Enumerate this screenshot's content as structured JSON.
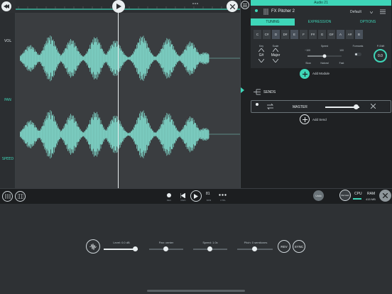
{
  "lanes": [
    "VOL",
    "PAN",
    "SPEED"
  ],
  "plugin": {
    "top_title": "Audio 21",
    "name": "FX Pitcher 2",
    "preset": "Default",
    "tabs": [
      "TUNING",
      "EXPRESSION",
      "OPTIONS"
    ],
    "notes": [
      "C",
      "C#",
      "D",
      "D#",
      "E",
      "F",
      "F#",
      "G",
      "G#",
      "A",
      "A#",
      "B"
    ],
    "key_label": "Key",
    "key_value": "G#",
    "scale_label": "Scale",
    "scale_value": "Major",
    "speed_label": "Speed",
    "speed_min": "−100",
    "speed_max": "100",
    "speed_slow": "Slow",
    "speed_natural": "Natural",
    "speed_fast": "Fast",
    "formants_label": "Formants",
    "pshift_label": "P-Shift",
    "pshift_value": "0.0"
  },
  "add_module": "Add Module",
  "sends": {
    "title": "SENDS",
    "master": "MASTER",
    "add_send": "Add Send"
  },
  "transport": {
    "rec": "REC",
    "rwd": "RWD",
    "bpm_value": "81",
    "bpm": "BPM",
    "ctrl": "CTRL",
    "undo": "Undo",
    "record_btn": "Recoset",
    "cpu": "CPU",
    "ram": "RAM",
    "ram_value": "415 MB"
  },
  "inspector": {
    "level": "Level: 0.0 dB",
    "pan": "Pan: center",
    "speed": "Speed: 1.0x",
    "pitch": "Pitch: 0 semitones",
    "rev": "REV",
    "sync": "SYNC"
  },
  "colors": {
    "accent": "#3ed6b8",
    "wave": "#7fd6c9"
  }
}
